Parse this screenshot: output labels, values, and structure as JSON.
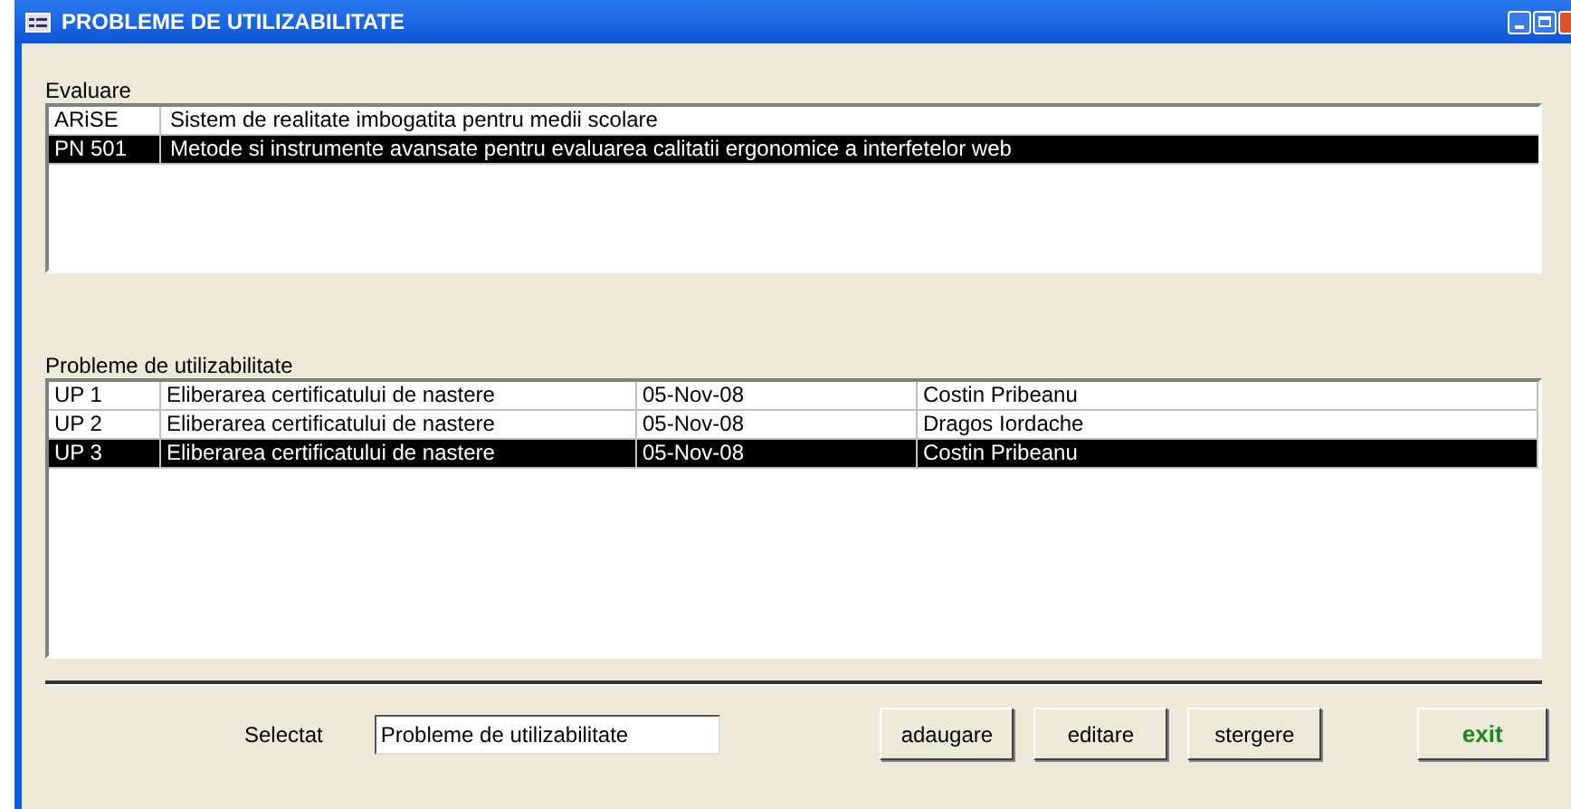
{
  "window": {
    "title": "PROBLEME DE UTILIZABILITATE"
  },
  "evaluare": {
    "label": "Evaluare",
    "rows": [
      {
        "code": "ARiSE",
        "name": "Sistem de realitate imbogatita pentru medii scolare",
        "selected": false
      },
      {
        "code": "PN 501",
        "name": "Metode si instrumente avansate pentru evaluarea calitatii ergonomice a interfetelor web",
        "selected": true
      }
    ]
  },
  "probleme": {
    "label": "Probleme de utilizabilitate",
    "rows": [
      {
        "cells": [
          "UP 1",
          "Eliberarea certificatului de nastere",
          "05-Nov-08",
          "Costin Pribeanu"
        ],
        "selected": false
      },
      {
        "cells": [
          "UP 2",
          "Eliberarea certificatului de nastere",
          "05-Nov-08",
          "Dragos Iordache"
        ],
        "selected": false
      },
      {
        "cells": [
          "UP 3",
          "Eliberarea certificatului de nastere",
          "05-Nov-08",
          "Costin Pribeanu"
        ],
        "selected": true
      }
    ]
  },
  "footer": {
    "label": "Selectat",
    "value": "Probleme de utilizabilitate",
    "buttons": [
      {
        "label": "adaugare",
        "kind": "normal"
      },
      {
        "label": "editare",
        "kind": "normal"
      },
      {
        "label": "stergere",
        "kind": "normal"
      },
      {
        "label": "exit",
        "kind": "exit"
      }
    ]
  }
}
